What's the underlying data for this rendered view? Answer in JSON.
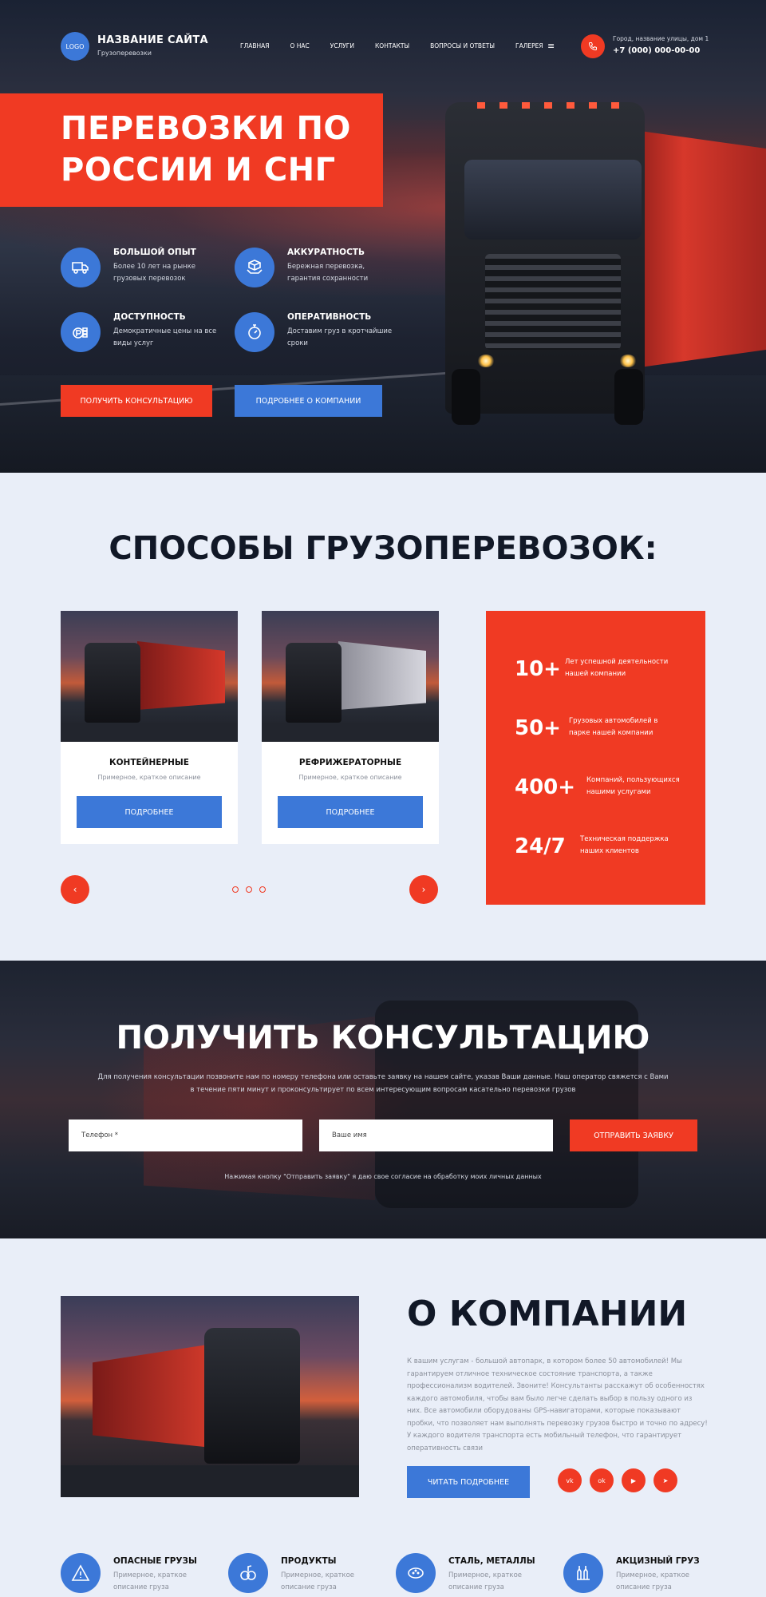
{
  "header": {
    "logo": "LOGO",
    "site_title": "НАЗВАНИЕ САЙТА",
    "site_subtitle": "Грузоперевозки",
    "nav": [
      "ГЛАВНАЯ",
      "О НАС",
      "УСЛУГИ",
      "КОНТАКТЫ",
      "ВОПРОСЫ И ОТВЕТЫ",
      "ГАЛЕРЕЯ"
    ],
    "menu_icon": "≡",
    "address": "Город, название улицы, дом 1",
    "phone": "+7 (000) 000-00-00"
  },
  "hero": {
    "title": "ПЕРЕВОЗКИ ПО РОССИИ И СНГ",
    "features": [
      {
        "icon": "truck-icon",
        "title": "БОЛЬШОЙ ОПЫТ",
        "text": "Более 10 лет на рынке грузовых перевозок"
      },
      {
        "icon": "box-hands-icon",
        "title": "АККУРАТНОСТЬ",
        "text": "Бережная перевозка, гарантия сохранности"
      },
      {
        "icon": "coins-icon",
        "title": "ДОСТУПНОСТЬ",
        "text": "Демократичные цены на все виды услуг"
      },
      {
        "icon": "stopwatch-icon",
        "title": "ОПЕРАТИВНОСТЬ",
        "text": "Доставим груз в кротчайшие сроки"
      }
    ],
    "btn_consult": "ПОЛУЧИТЬ КОНСУЛЬТАЦИЮ",
    "btn_about": "ПОДРОБНЕЕ О КОМПАНИИ"
  },
  "services": {
    "title": "СПОСОБЫ ГРУЗОПЕРЕВОЗОК:",
    "cards": [
      {
        "title": "КОНТЕЙНЕРНЫЕ",
        "desc": "Примерное, краткое описание",
        "button": "ПОДРОБНЕЕ"
      },
      {
        "title": "РЕФРИЖЕРАТОРНЫЕ",
        "desc": "Примерное, краткое описание",
        "button": "ПОДРОБНЕЕ"
      }
    ],
    "prev_icon": "‹",
    "next_icon": "›",
    "slides": 3,
    "stats": [
      {
        "num": "10+",
        "text": "Лет успешной деятельности нашей компании"
      },
      {
        "num": "50+",
        "text": "Грузовых автомобилей в парке нашей компании"
      },
      {
        "num": "400+",
        "text": "Компаний, пользующихся нашими услугами"
      },
      {
        "num": "24/7",
        "text": "Техническая поддержка наших клиентов"
      }
    ]
  },
  "consult": {
    "title": "ПОЛУЧИТЬ КОНСУЛЬТАЦИЮ",
    "text": "Для получения консультации позвоните нам по номеру телефона или оставьте заявку на нашем сайте, указав Ваши данные. Наш оператор свяжется с Вами в течение пяти минут и проконсультирует по всем интересующим вопросам касательно перевозки грузов",
    "phone_placeholder": "Телефон *",
    "name_placeholder": "Ваше имя",
    "submit": "ОТПРАВИТЬ ЗАЯВКУ",
    "note": "Нажимая кнопку \"Отправить заявку\" я даю свое согласие на обработку моих личных данных"
  },
  "about": {
    "title": "О КОМПАНИИ",
    "text": "К вашим услугам - большой автопарк, в котором более 50 автомобилей! Мы гарантируем отличное техническое состояние транспорта, а также профессионализм водителей. Звоните! Консультанты расскажут об особенностях каждого автомобиля, чтобы вам было легче сделать выбор в пользу одного из них. Все автомобили оборудованы GPS-навигаторами, которые показывают пробки, что позволяет нам выполнять перевозку грузов быстро и точно по адресу! У каждого водителя транспорта есть мобильный телефон, что гарантирует оперативность связи",
    "button": "ЧИТАТЬ ПОДРОБНЕЕ",
    "socials": [
      "vk-icon",
      "ok-icon",
      "youtube-icon",
      "telegram-icon"
    ],
    "social_labels": [
      "vk",
      "ok",
      "▶",
      "➤"
    ]
  },
  "cargo": [
    {
      "icon": "warning-icon",
      "title": "ОПАСНЫЕ ГРУЗЫ",
      "text": "Примерное, краткое описание груза"
    },
    {
      "icon": "fruit-icon",
      "title": "ПРОДУКТЫ",
      "text": "Примерное, краткое описание груза"
    },
    {
      "icon": "steel-icon",
      "title": "СТАЛЬ, МЕТАЛЛЫ",
      "text": "Примерное, краткое описание груза"
    },
    {
      "icon": "bottles-icon",
      "title": "АКЦИЗНЫЙ ГРУЗ",
      "text": "Примерное, краткое описание груза"
    }
  ],
  "colors": {
    "accent_red": "#f03a23",
    "accent_blue": "#3c78d8",
    "light_bg": "#e9eef8"
  }
}
